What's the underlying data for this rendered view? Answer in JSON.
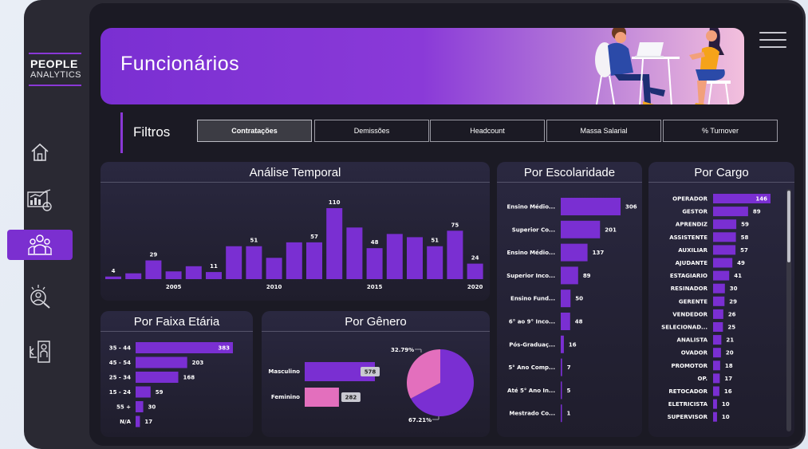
{
  "brand": {
    "line1": "PEOPLE",
    "line2": "ANALYTICS"
  },
  "sidebar": {
    "items": [
      {
        "name": "home",
        "icon": "home-icon"
      },
      {
        "name": "dashboard",
        "icon": "dashboard-chart-icon"
      },
      {
        "name": "team",
        "icon": "team-icon",
        "active": true
      },
      {
        "name": "recruit",
        "icon": "person-search-icon"
      },
      {
        "name": "exit",
        "icon": "exit-door-icon"
      }
    ]
  },
  "header": {
    "title": "Funcionários"
  },
  "filters": {
    "label": "Filtros",
    "tabs": [
      "Contratações",
      "Demissões",
      "Headcount",
      "Massa Salarial",
      "% Turnover"
    ],
    "active": "Contratações"
  },
  "colors": {
    "accent": "#7b2fd0",
    "bar": "#7a2fd2",
    "female": "#e36fbd",
    "panel": "#24223a"
  },
  "chart_data": [
    {
      "id": "temporal",
      "type": "bar",
      "title": "Análise Temporal",
      "categories": [
        "2002",
        "2003",
        "2004",
        "2005",
        "2006",
        "2007",
        "2008",
        "2009",
        "2010",
        "2011",
        "2012",
        "2013",
        "2014",
        "2015",
        "2016",
        "2017",
        "2018",
        "2019",
        "2020"
      ],
      "values": [
        4,
        9,
        29,
        12,
        20,
        11,
        51,
        51,
        33,
        57,
        57,
        110,
        80,
        48,
        70,
        65,
        51,
        75,
        24
      ],
      "data_labels": {
        "0": "4",
        "2": "29",
        "5": "11",
        "7": "51",
        "10": "57",
        "11": "110",
        "13": "48",
        "16": "51",
        "17": "75",
        "18": "24"
      },
      "x_ticks": {
        "3": "2005",
        "8": "2010",
        "13": "2015",
        "18": "2020"
      },
      "ylim": [
        0,
        110
      ]
    },
    {
      "id": "escolaridade",
      "type": "bar",
      "title": "Por Escolaridade",
      "categories": [
        "Ensino Médio...",
        "Superior Co...",
        "Ensino Médio...",
        "Superior Inco...",
        "Ensino Fund...",
        "6° ao 9° Inco...",
        "Pós-Graduaç...",
        "5° Ano Comp...",
        "Até 5° Ano In...",
        "Mestrado Co..."
      ],
      "values": [
        306,
        201,
        137,
        89,
        50,
        48,
        16,
        7,
        5,
        1
      ]
    },
    {
      "id": "cargo",
      "type": "bar",
      "title": "Por Cargo",
      "categories": [
        "OPERADOR",
        "GESTOR",
        "APRENDIZ",
        "ASSISTENTE",
        "AUXILIAR",
        "AJUDANTE",
        "ESTAGIARIO",
        "RESINADOR",
        "GERENTE",
        "VENDEDOR",
        "SELECIONAD...",
        "ANALISTA",
        "OVADOR",
        "PROMOTOR",
        "OP.",
        "RETOCADOR",
        "ELETRICISTA",
        "SUPERVISOR"
      ],
      "values": [
        146,
        89,
        59,
        58,
        57,
        49,
        41,
        30,
        29,
        26,
        25,
        21,
        20,
        18,
        17,
        16,
        10,
        10
      ]
    },
    {
      "id": "faixa",
      "type": "bar",
      "title": "Por Faixa Etária",
      "categories": [
        "35 - 44",
        "45 - 54",
        "25 - 34",
        "15 - 24",
        "55 +",
        "N/A"
      ],
      "values": [
        383,
        203,
        168,
        59,
        30,
        17
      ]
    },
    {
      "id": "genero",
      "type": "bar",
      "title": "Por Gênero",
      "categories": [
        "Masculino",
        "Feminino"
      ],
      "values": [
        578,
        282
      ]
    },
    {
      "id": "genero-pie",
      "type": "pie",
      "slices": [
        {
          "label": "67.21%",
          "value": 67.21
        },
        {
          "label": "32.79%",
          "value": 32.79
        }
      ]
    }
  ]
}
